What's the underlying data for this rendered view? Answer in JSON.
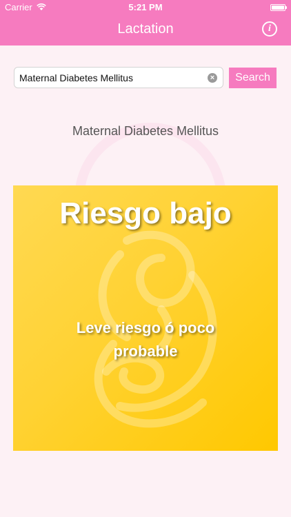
{
  "status_bar": {
    "carrier": "Carrier",
    "time": "5:21 PM"
  },
  "nav": {
    "title": "Lactation",
    "info_icon": "info-icon",
    "info_glyph": "i"
  },
  "search": {
    "value": "Maternal Diabetes Mellitus",
    "button_label": "Search"
  },
  "result": {
    "query_label": "Maternal Diabetes Mellitus",
    "risk_title": "Riesgo bajo",
    "risk_description": "Leve riesgo ó poco probable",
    "card_color": "#ffd233"
  },
  "colors": {
    "accent": "#f67bbf",
    "background": "#fdf1f5"
  }
}
